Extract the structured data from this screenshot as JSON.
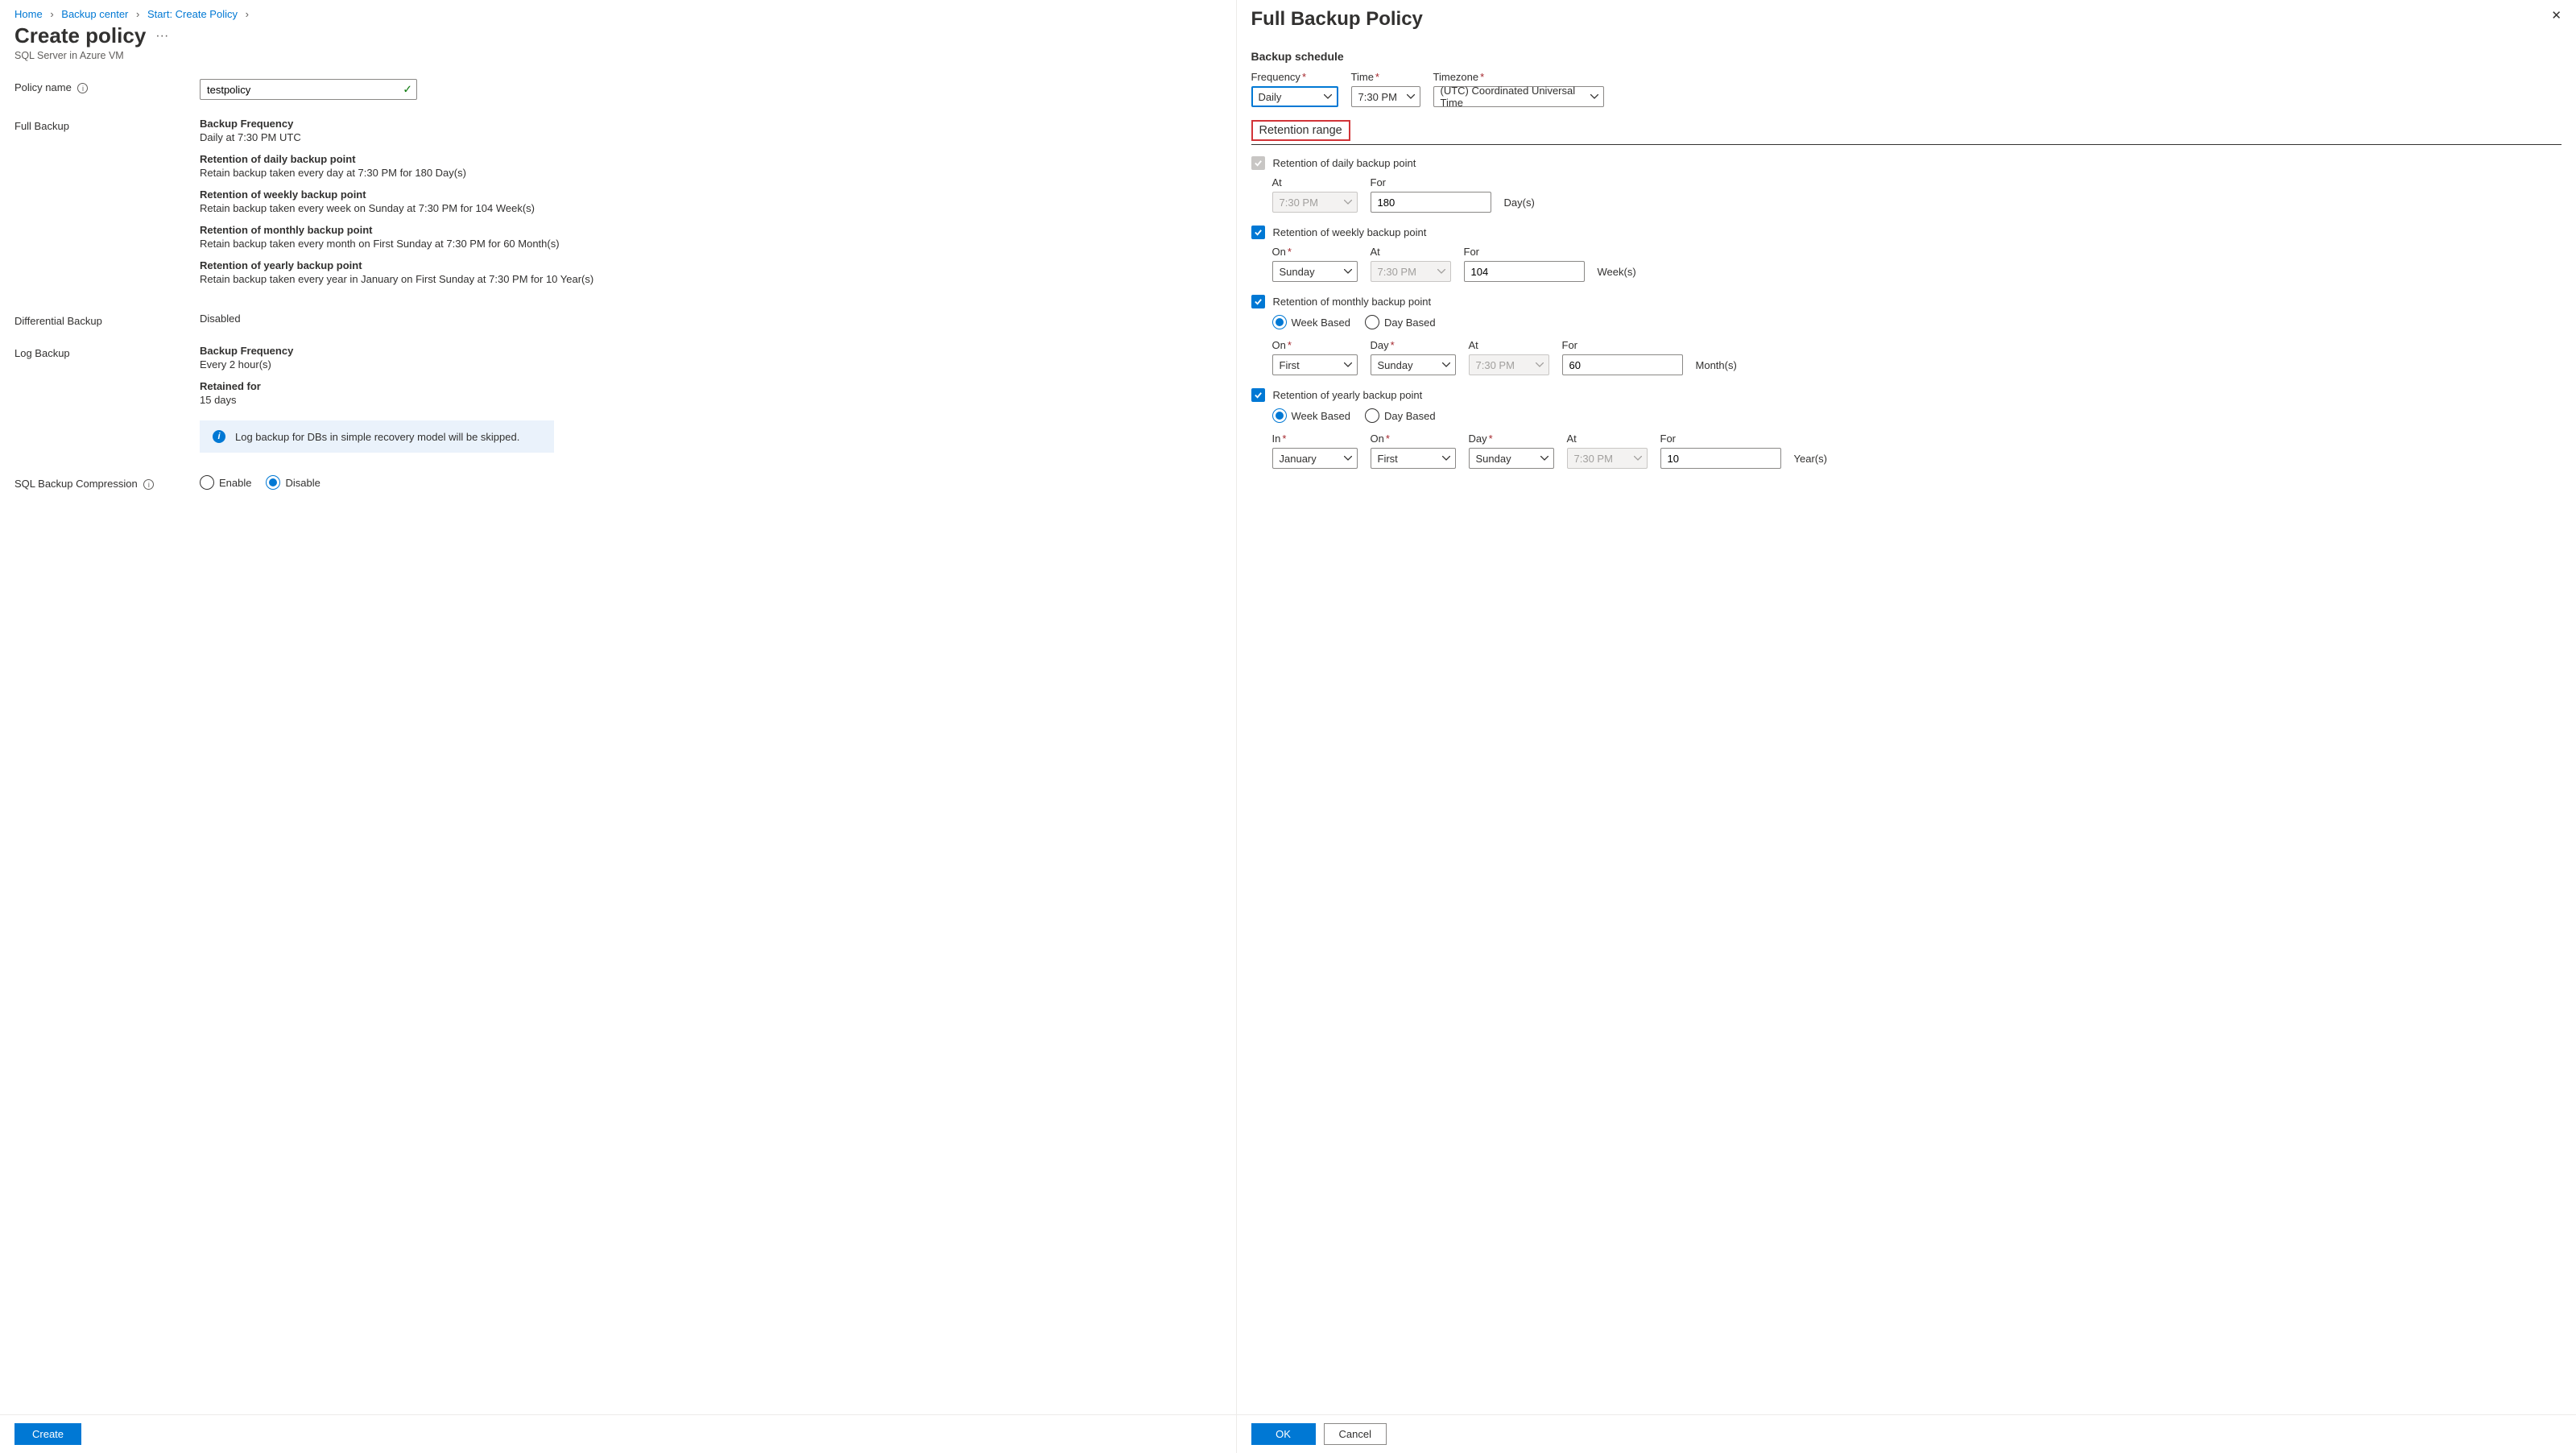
{
  "breadcrumb": {
    "items": [
      "Home",
      "Backup center",
      "Start: Create Policy"
    ]
  },
  "left": {
    "title": "Create policy",
    "subtitle": "SQL Server in Azure VM",
    "policy_name_label": "Policy name",
    "policy_name_value": "testpolicy",
    "full_backup_label": "Full Backup",
    "full_backup": {
      "freq_h": "Backup Frequency",
      "freq_v": "Daily at 7:30 PM UTC",
      "daily_h": "Retention of daily backup point",
      "daily_v": "Retain backup taken every day at 7:30 PM for 180 Day(s)",
      "weekly_h": "Retention of weekly backup point",
      "weekly_v": "Retain backup taken every week on Sunday at 7:30 PM for 104 Week(s)",
      "monthly_h": "Retention of monthly backup point",
      "monthly_v": "Retain backup taken every month on First Sunday at 7:30 PM for 60 Month(s)",
      "yearly_h": "Retention of yearly backup point",
      "yearly_v": "Retain backup taken every year in January on First Sunday at 7:30 PM for 10 Year(s)"
    },
    "diff_label": "Differential Backup",
    "diff_value": "Disabled",
    "log_label": "Log Backup",
    "log": {
      "freq_h": "Backup Frequency",
      "freq_v": "Every 2 hour(s)",
      "ret_h": "Retained for",
      "ret_v": "15 days"
    },
    "info_banner": "Log backup for DBs in simple recovery model will be skipped.",
    "compression_label": "SQL Backup Compression",
    "compression_enable": "Enable",
    "compression_disable": "Disable",
    "create_btn": "Create"
  },
  "right": {
    "title": "Full Backup Policy",
    "schedule_heading": "Backup schedule",
    "freq_label": "Frequency",
    "freq_value": "Daily",
    "time_label": "Time",
    "time_value": "7:30 PM",
    "tz_label": "Timezone",
    "tz_value": "(UTC) Coordinated Universal Time",
    "retention_heading": "Retention range",
    "daily": {
      "cb_label": "Retention of daily backup point",
      "at_label": "At",
      "at_value": "7:30 PM",
      "for_label": "For",
      "for_value": "180",
      "unit": "Day(s)"
    },
    "weekly": {
      "cb_label": "Retention of weekly backup point",
      "on_label": "On",
      "on_value": "Sunday",
      "at_label": "At",
      "at_value": "7:30 PM",
      "for_label": "For",
      "for_value": "104",
      "unit": "Week(s)"
    },
    "monthly": {
      "cb_label": "Retention of monthly backup point",
      "week_based": "Week Based",
      "day_based": "Day Based",
      "on_label": "On",
      "on_value": "First",
      "day_label": "Day",
      "day_value": "Sunday",
      "at_label": "At",
      "at_value": "7:30 PM",
      "for_label": "For",
      "for_value": "60",
      "unit": "Month(s)"
    },
    "yearly": {
      "cb_label": "Retention of yearly backup point",
      "week_based": "Week Based",
      "day_based": "Day Based",
      "in_label": "In",
      "in_value": "January",
      "on_label": "On",
      "on_value": "First",
      "day_label": "Day",
      "day_value": "Sunday",
      "at_label": "At",
      "at_value": "7:30 PM",
      "for_label": "For",
      "for_value": "10",
      "unit": "Year(s)"
    },
    "ok_btn": "OK",
    "cancel_btn": "Cancel"
  }
}
